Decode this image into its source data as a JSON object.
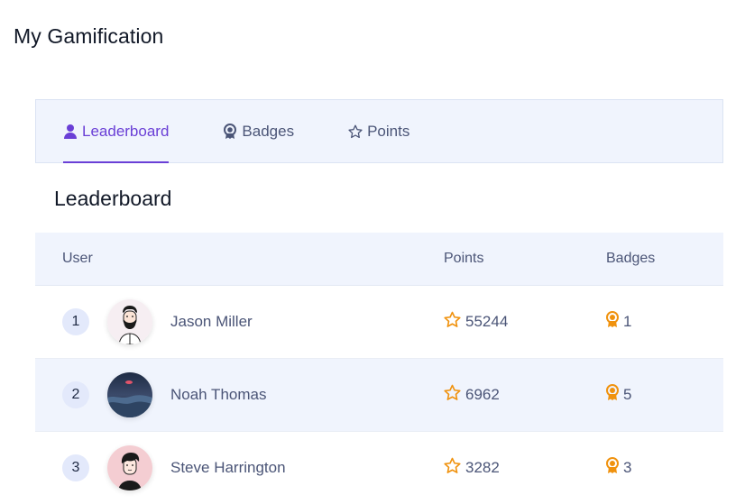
{
  "page": {
    "title": "My Gamification"
  },
  "tabs": [
    {
      "label": "Leaderboard",
      "icon": "user-icon",
      "active": true
    },
    {
      "label": "Badges",
      "icon": "badge-icon",
      "active": false
    },
    {
      "label": "Points",
      "icon": "star-icon",
      "active": false
    }
  ],
  "leaderboard": {
    "title": "Leaderboard",
    "columns": {
      "user": "User",
      "points": "Points",
      "badges": "Badges"
    },
    "rows": [
      {
        "rank": "1",
        "name": "Jason Miller",
        "points": "55244",
        "badges": "1",
        "avatar": "bearded-man-avatar"
      },
      {
        "rank": "2",
        "name": "Noah Thomas",
        "points": "6962",
        "badges": "5",
        "avatar": "night-sea-avatar"
      },
      {
        "rank": "3",
        "name": "Steve Harrington",
        "points": "3282",
        "badges": "3",
        "avatar": "man-illustration-avatar"
      }
    ]
  },
  "colors": {
    "accent": "#6a3fd6",
    "icon_orange": "#f0920e",
    "header_bg": "#f0f4fd"
  }
}
